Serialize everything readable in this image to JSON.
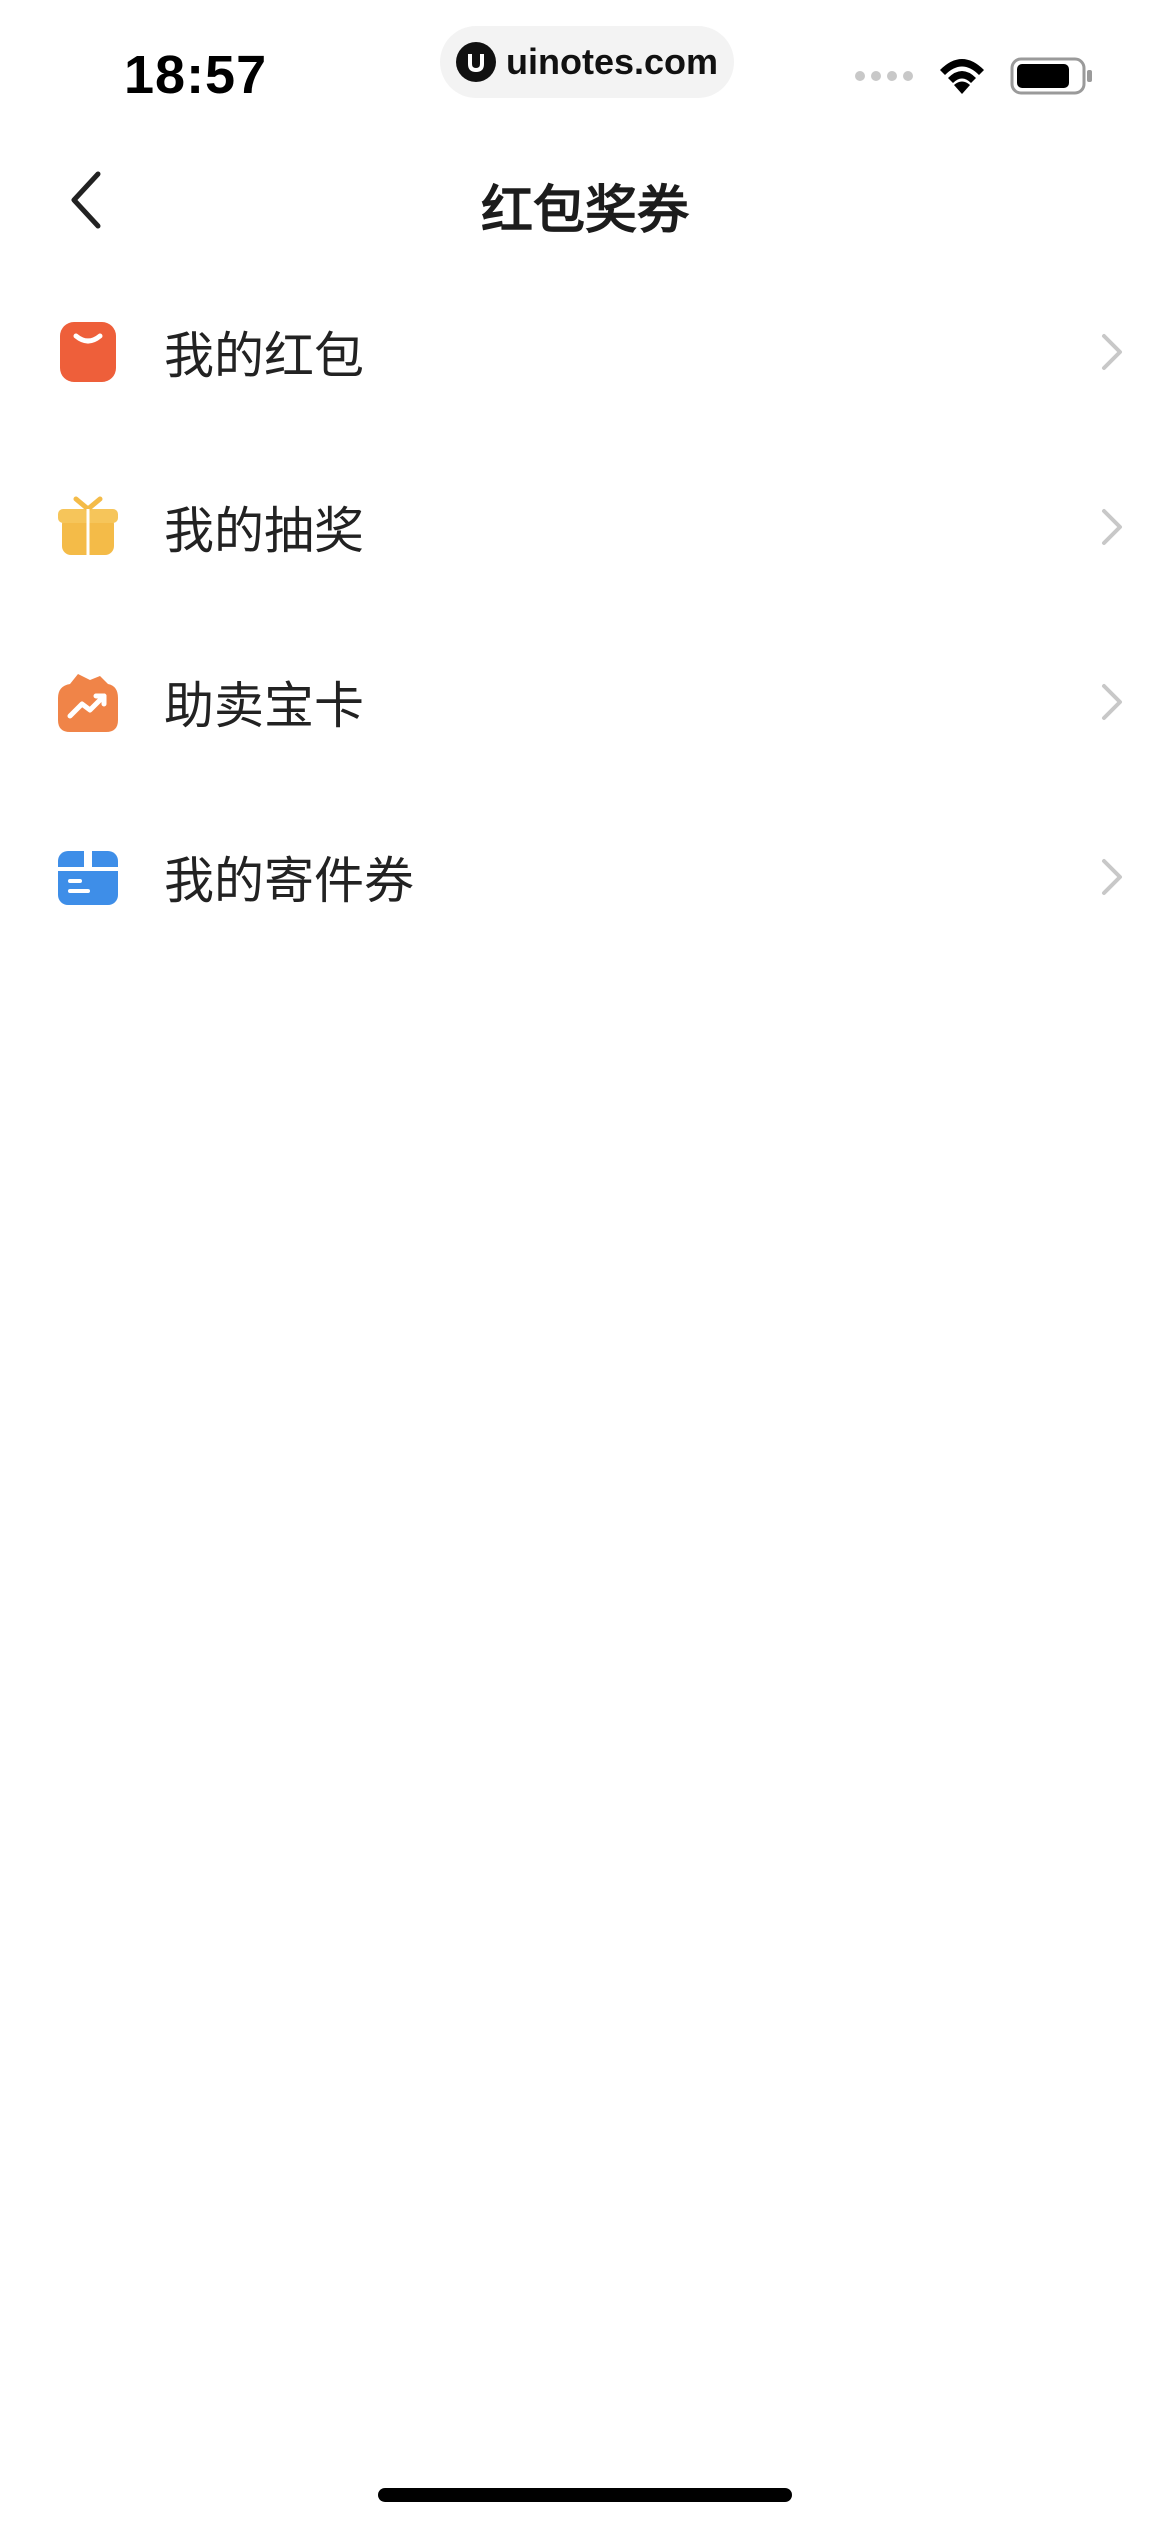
{
  "status_bar": {
    "time": "18:57",
    "url": "uinotes.com"
  },
  "nav": {
    "title": "红包奖券"
  },
  "menu": {
    "items": [
      {
        "label": "我的红包",
        "icon": "red-envelope-icon",
        "color": "#EE5F3A"
      },
      {
        "label": "我的抽奖",
        "icon": "gift-box-icon",
        "color": "#F4BB48"
      },
      {
        "label": "助卖宝卡",
        "icon": "boost-sale-icon",
        "color": "#F08448"
      },
      {
        "label": "我的寄件券",
        "icon": "package-icon",
        "color": "#3E8EE8"
      }
    ]
  },
  "colors": {
    "chevron": "#C8C8C8",
    "text": "#222222",
    "background": "#FFFFFF"
  }
}
